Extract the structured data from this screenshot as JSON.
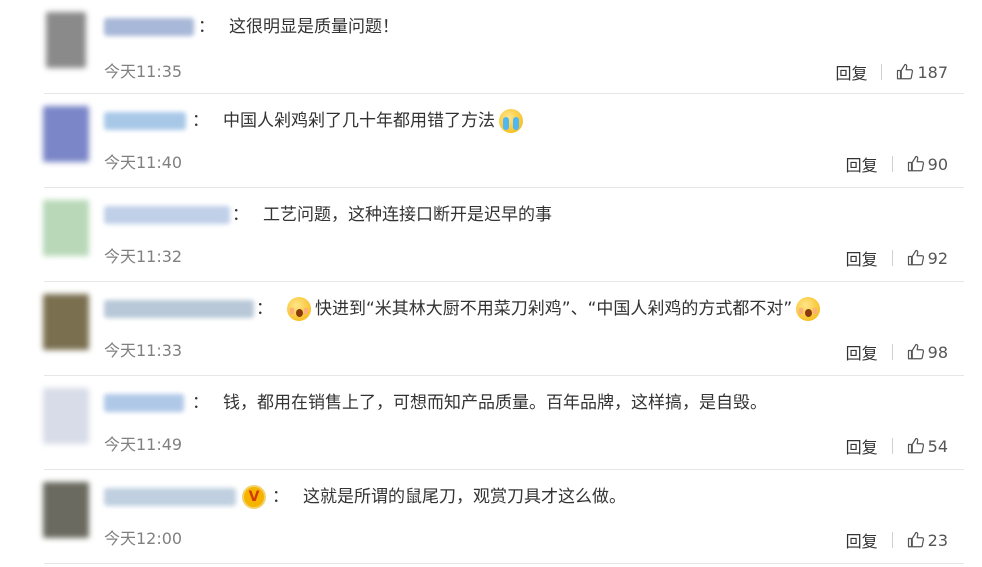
{
  "comments": [
    {
      "content": "这很明显是质量问题！",
      "time": "今天11:35",
      "reply": "回复",
      "likes": "187",
      "avatar_color": "#8a8a8a",
      "name_color": "#a8b8d8"
    },
    {
      "content": "中国人剁鸡剁了几十年都用错了方法",
      "emoji_after": "crying-face-emoji",
      "time": "今天11:40",
      "reply": "回复",
      "likes": "90",
      "avatar_color": "#7a86c8",
      "name_color": "#a8c8e8"
    },
    {
      "content": "工艺问题，这种连接口断开是迟早的事",
      "time": "今天11:32",
      "reply": "回复",
      "likes": "92",
      "avatar_color": "#b8d8b8",
      "name_color": "#c0d0e8"
    },
    {
      "content": "快进到“米其林大厨不用菜刀剁鸡”、“中国人剁鸡的方式都不对”",
      "emoji_before": "screaming-face-emoji",
      "emoji_after": "screaming-face-emoji",
      "time": "今天11:33",
      "reply": "回复",
      "likes": "98",
      "avatar_color": "#7a7050",
      "name_color": "#b8c8d8"
    },
    {
      "content": "钱，都用在销售上了，可想而知产品质量。百年品牌，这样搞，是自毁。",
      "time": "今天11:49",
      "reply": "回复",
      "likes": "54",
      "avatar_color": "#d8dce8",
      "name_color": "#b0c8e8"
    },
    {
      "content": "这就是所谓的鼠尾刀，观赏刀具才这么做。",
      "badge": "V",
      "time": "今天12:00",
      "reply": "回复",
      "likes": "23",
      "avatar_color": "#6a6a60",
      "name_color": "#c0d0e0"
    }
  ]
}
